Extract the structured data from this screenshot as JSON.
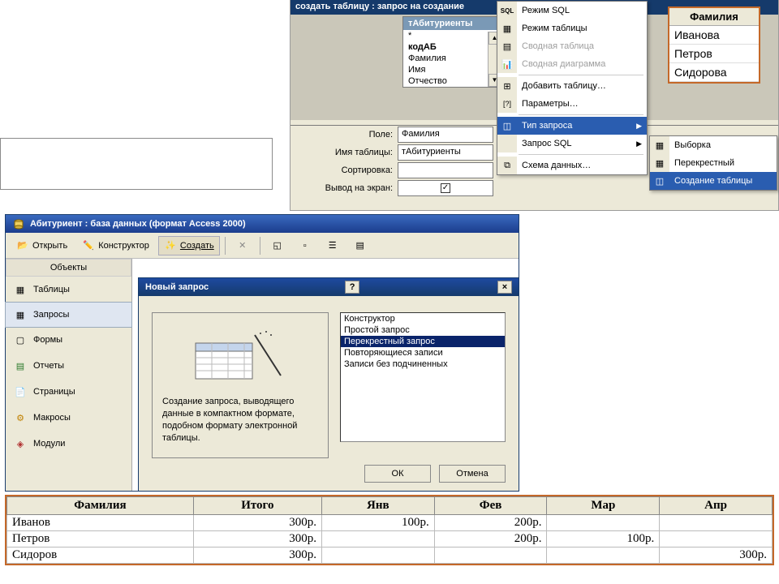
{
  "qd": {
    "title": "создать таблицу : запрос на создание",
    "tbox_title": "тАбитуриенты",
    "fields": [
      "*",
      "кодАБ",
      "Фамилия",
      "Имя",
      "Отчество"
    ],
    "labels": {
      "field": "Поле:",
      "table": "Имя таблицы:",
      "sort": "Сортировка:",
      "show": "Вывод на экран:"
    },
    "row_field": "Фамилия",
    "row_table": "тАбитуриенты",
    "chk": "✓"
  },
  "rgrid": {
    "header": "Фамилия",
    "rows": [
      "Иванова",
      "Петров",
      "Сидорова"
    ]
  },
  "menu": {
    "sql": "Режим SQL",
    "table": "Режим таблицы",
    "pivot": "Сводная таблица",
    "chart": "Сводная диаграмма",
    "addtable": "Добавить таблицу…",
    "params": "Параметры…",
    "qtype": "Тип запроса",
    "sqlq": "Запрос SQL",
    "schema": "Схема данных…"
  },
  "submenu": {
    "select": "Выборка",
    "cross": "Перекрестный",
    "maketable": "Создание таблицы"
  },
  "db": {
    "title": "Абитуриент : база данных (формат Access 2000)",
    "open": "Открыть",
    "design": "Конструктор",
    "create": "Создать",
    "objects": "Объекты",
    "side": {
      "tables": "Таблицы",
      "queries": "Запросы",
      "forms": "Формы",
      "reports": "Отчеты",
      "pages": "Страницы",
      "macros": "Макросы",
      "modules": "Модули"
    }
  },
  "dlg": {
    "title": "Новый запрос",
    "preview": "Создание запроса, выводящего данные в компактном формате, подобном формату электронной таблицы.",
    "items": [
      "Конструктор",
      "Простой запрос",
      "Перекрестный запрос",
      "Повторяющиеся записи",
      "Записи без подчиненных"
    ],
    "ok": "ОК",
    "cancel": "Отмена"
  },
  "result": {
    "headers": [
      "Фамилия",
      "Итого",
      "Янв",
      "Фев",
      "Мар",
      "Апр"
    ],
    "rows": [
      {
        "name": "Иванов",
        "total": "300р.",
        "jan": "100р.",
        "feb": "200р.",
        "mar": "",
        "apr": ""
      },
      {
        "name": "Петров",
        "total": "300р.",
        "jan": "",
        "feb": "200р.",
        "mar": "100р.",
        "apr": ""
      },
      {
        "name": "Сидоров",
        "total": "300р.",
        "jan": "",
        "feb": "",
        "mar": "",
        "apr": "300р."
      }
    ]
  }
}
